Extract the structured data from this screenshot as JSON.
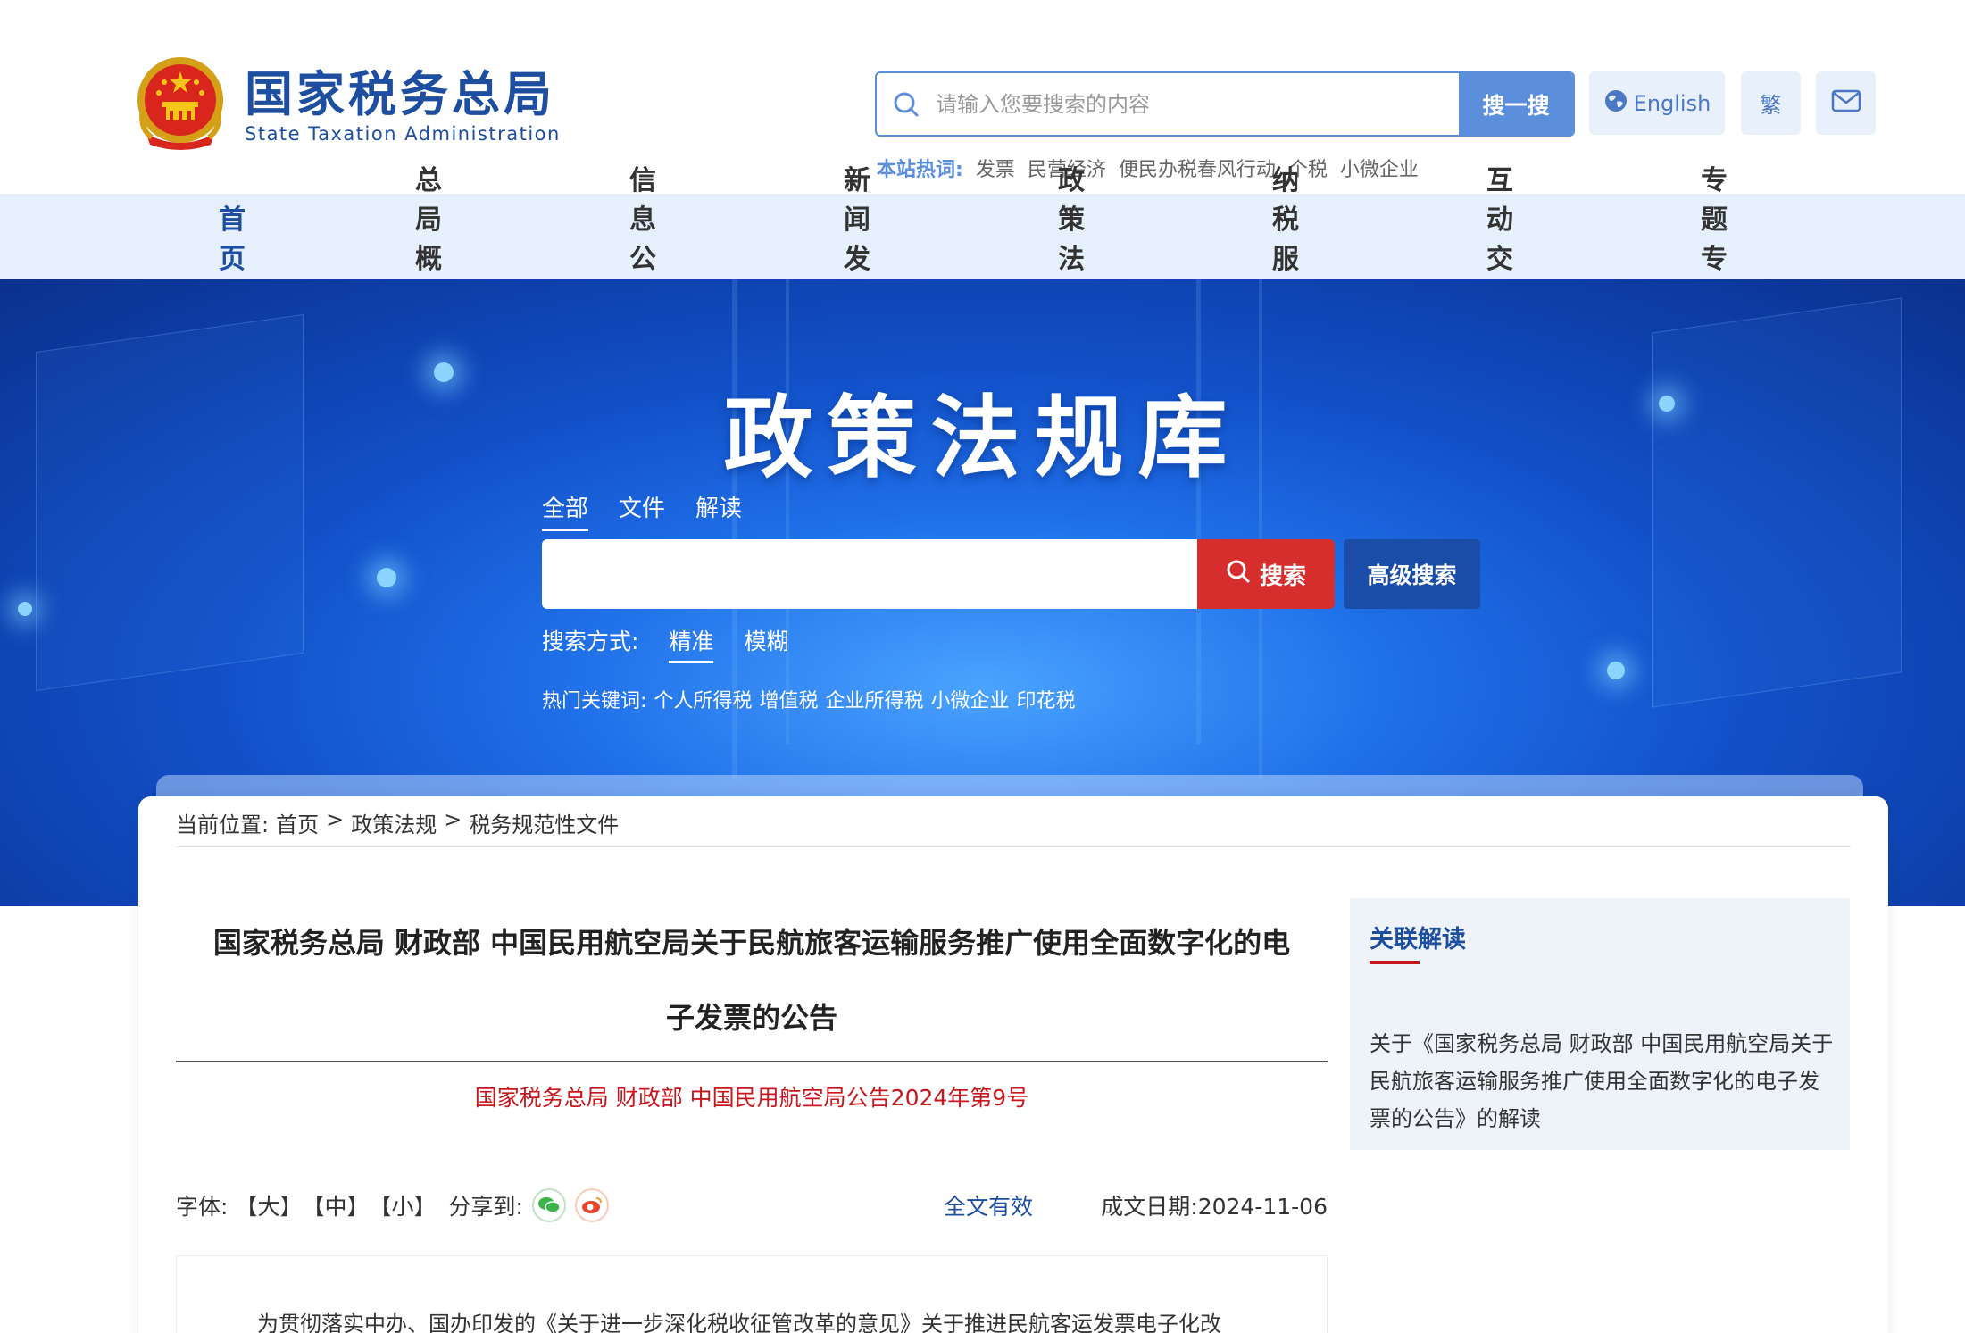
{
  "header": {
    "logo_cn": "国家税务总局",
    "logo_en": "State Taxation Administration",
    "search_placeholder": "请输入您要搜索的内容",
    "search_button": "搜一搜",
    "english_label": "English",
    "traditional_label": "繁",
    "hotwords_label": "本站热词:",
    "hotwords": [
      "发票",
      "民营经济",
      "便民办税春风行动",
      "个税",
      "小微企业"
    ],
    "icons": {
      "search": "search-icon",
      "globe": "globe-icon",
      "mail": "mail-icon"
    }
  },
  "nav": {
    "items": [
      "首页",
      "总局概况",
      "信息公开",
      "新闻发布",
      "政策法规",
      "纳税服务",
      "互动交流",
      "专题专栏"
    ],
    "active": "首页"
  },
  "banner": {
    "title": "政策法规库",
    "tabs": [
      "全部",
      "文件",
      "解读"
    ],
    "active_tab": "全部",
    "search_button": "搜索",
    "advanced_button": "高级搜索",
    "mode_label": "搜索方式:",
    "modes": [
      "精准",
      "模糊"
    ],
    "active_mode": "精准",
    "hot_label": "热门关键词:",
    "hot_keywords": [
      "个人所得税",
      "增值税",
      "企业所得税",
      "小微企业",
      "印花税"
    ]
  },
  "breadcrumb": {
    "label": "当前位置:",
    "items": [
      "首页",
      "政策法规",
      "税务规范性文件"
    ],
    "sep": ">"
  },
  "article": {
    "title_line1": "国家税务总局 财政部 中国民用航空局关于民航旅客运输服务推广使用全面数字化的电",
    "title_line2": "子发票的公告",
    "doc_number": "国家税务总局 财政部 中国民用航空局公告2024年第9号",
    "font_label": "字体:",
    "font_sizes": [
      "【大】",
      "【中】",
      "【小】"
    ],
    "share_label": "分享到:",
    "validity": "全文有效",
    "date_label": "成文日期:",
    "date": "2024-11-06",
    "body_first_line": "为贯彻落实中办、国办印发的《关于进一步深化税收征管改革的意见》关于推进民航客运发票电子化改"
  },
  "sidebar": {
    "heading": "关联解读",
    "link": "关于《国家税务总局 财政部 中国民用航空局关于民航旅客运输服务推广使用全面数字化的电子发票的公告》的解读"
  },
  "colors": {
    "brand_blue": "#1d4ea0",
    "search_blue": "#5b8fdb",
    "nav_bg": "#e6f0fc",
    "accent_red": "#d62d2d",
    "doc_red": "#c8161d"
  }
}
